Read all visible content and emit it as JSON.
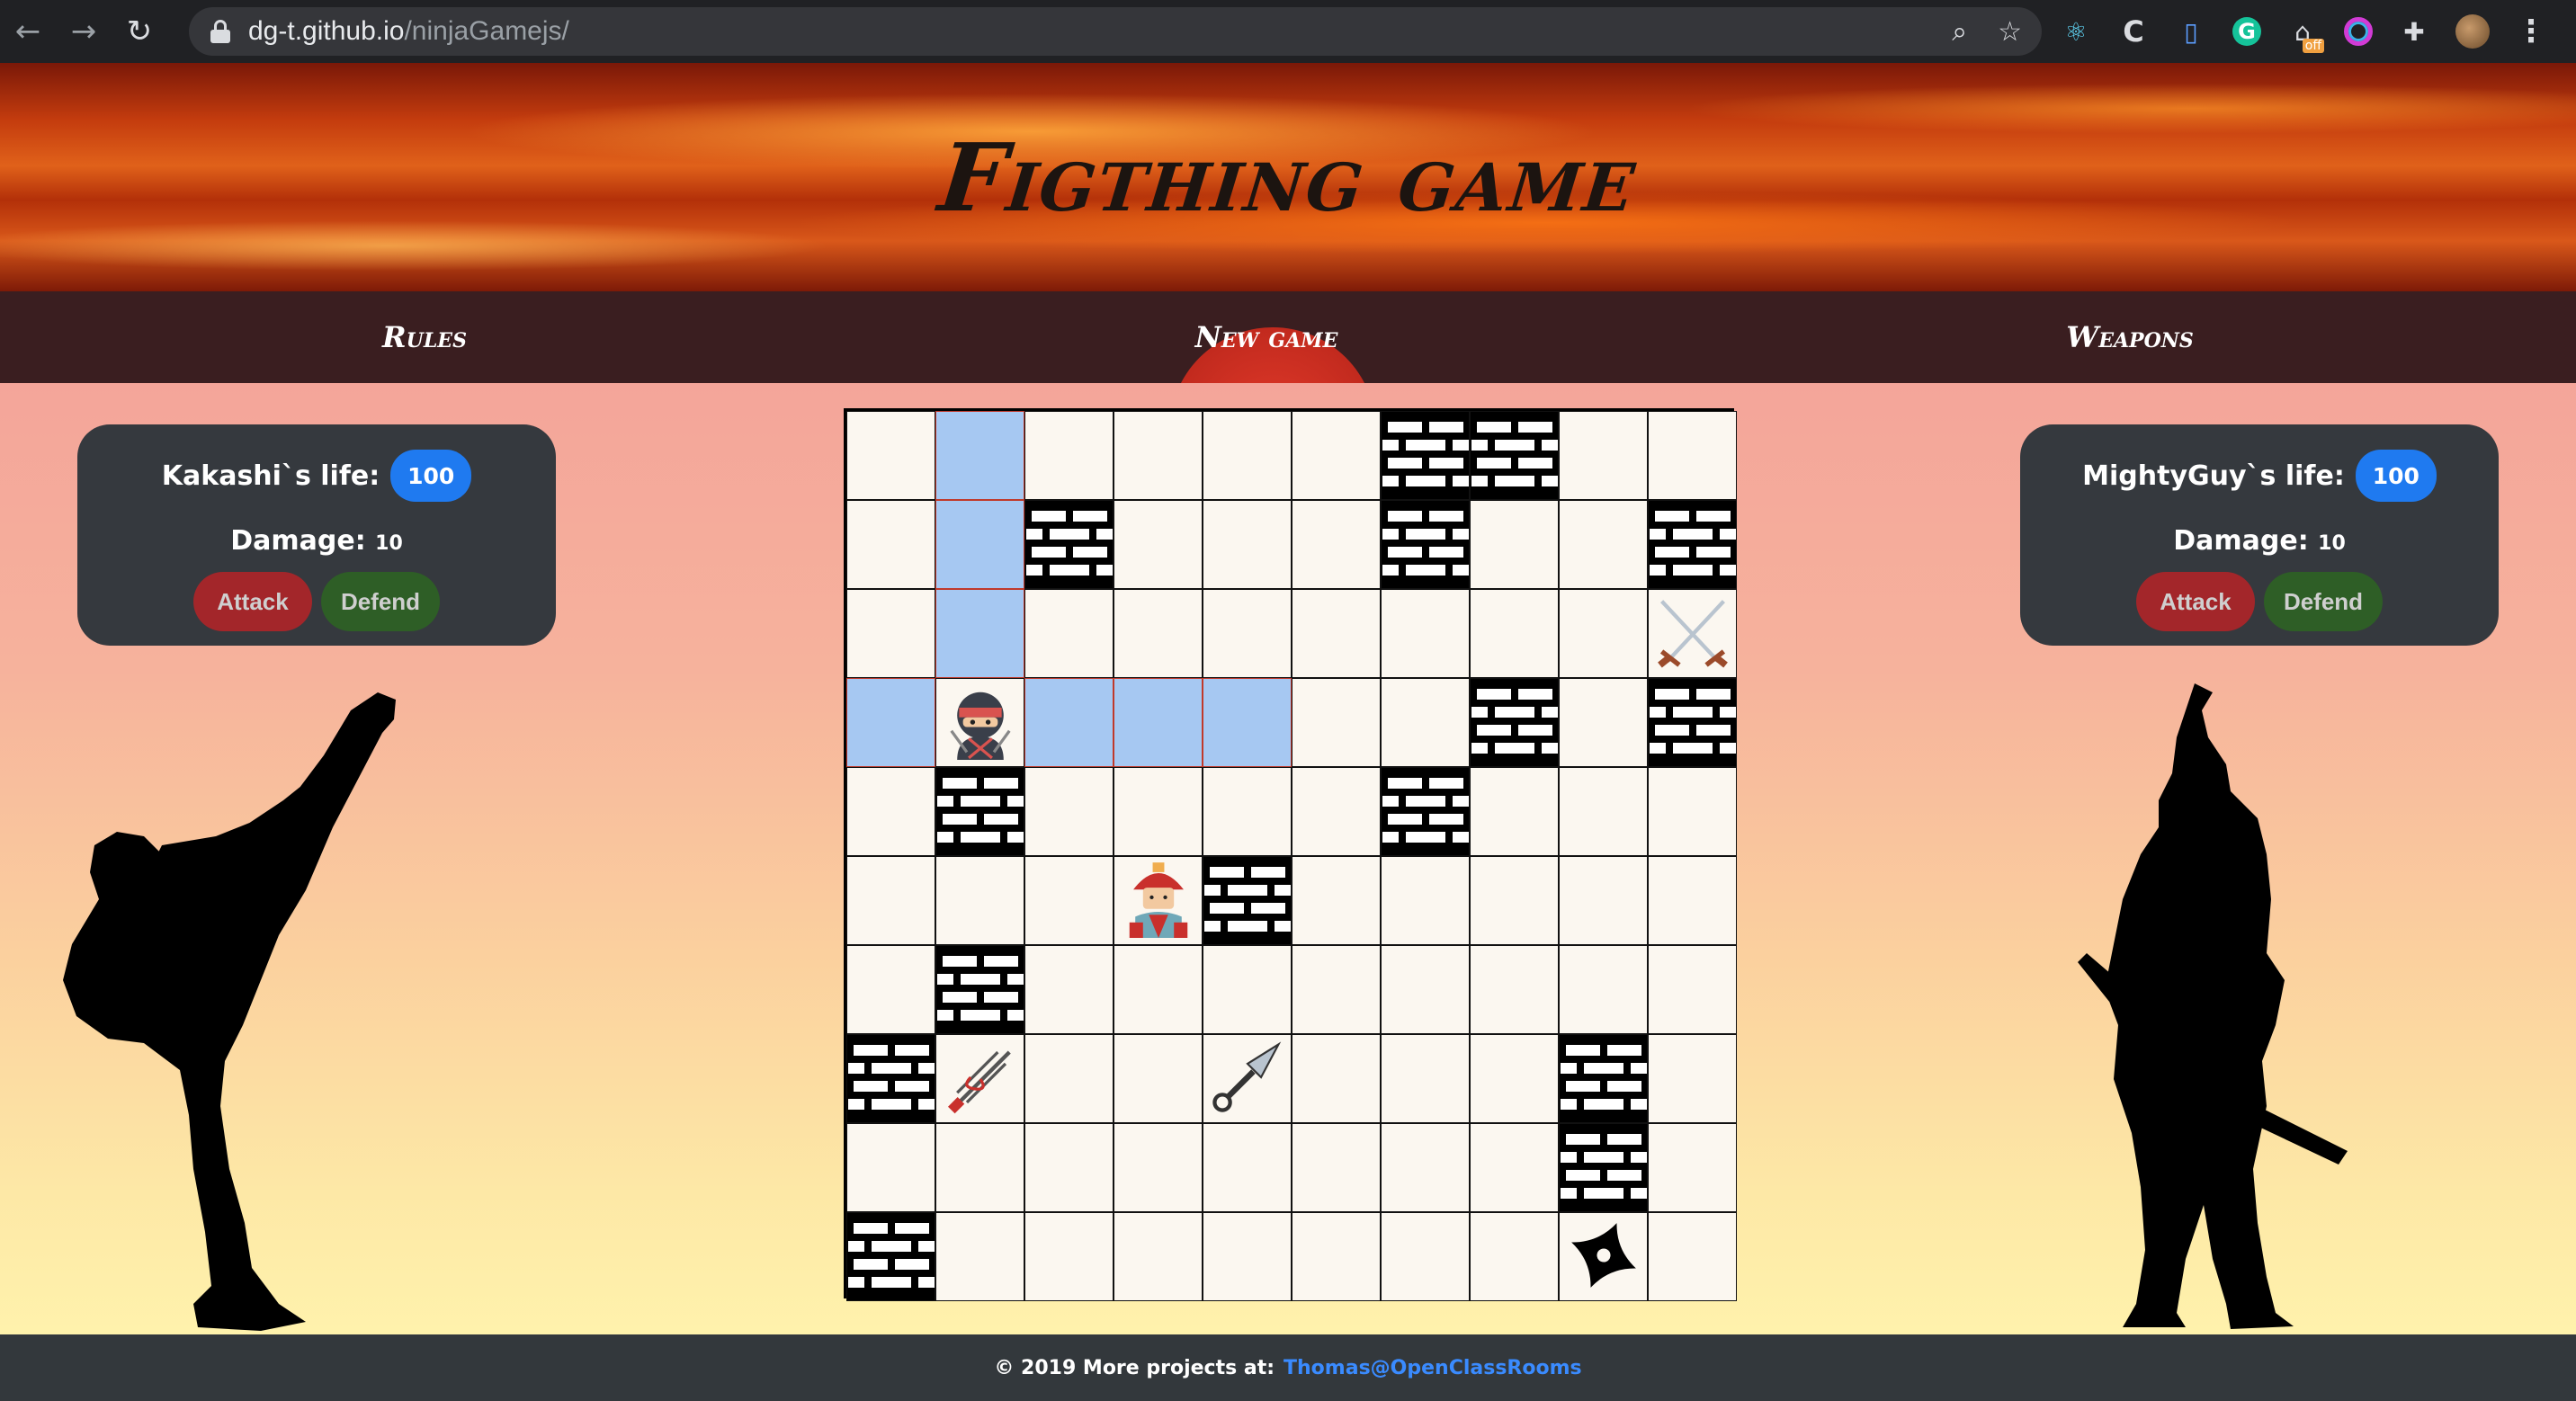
{
  "browser": {
    "url_host": "dg-t.github.io",
    "url_path": "/ninjaGamejs/",
    "ext_badge": "off"
  },
  "header": {
    "title": "Figthing game"
  },
  "nav": {
    "rules": "Rules",
    "new_game": "New game",
    "weapons": "Weapons"
  },
  "player1": {
    "life_label": "Kakashi`s life:",
    "life": "100",
    "damage_label": "Damage:",
    "damage": "10",
    "attack": "Attack",
    "defend": "Defend"
  },
  "player2": {
    "life_label": "MightyGuy`s life:",
    "life": "100",
    "damage_label": "Damage:",
    "damage": "10",
    "attack": "Attack",
    "defend": "Defend"
  },
  "board": {
    "size": 10,
    "walls": [
      [
        0,
        6
      ],
      [
        0,
        7
      ],
      [
        1,
        2
      ],
      [
        1,
        6
      ],
      [
        1,
        9
      ],
      [
        3,
        7
      ],
      [
        3,
        9
      ],
      [
        4,
        1
      ],
      [
        4,
        6
      ],
      [
        5,
        4
      ],
      [
        6,
        1
      ],
      [
        7,
        0
      ],
      [
        7,
        8
      ],
      [
        8,
        8
      ],
      [
        9,
        0
      ]
    ],
    "moves": [
      [
        0,
        1
      ],
      [
        1,
        1
      ],
      [
        2,
        1
      ],
      [
        3,
        0
      ],
      [
        3,
        2
      ],
      [
        3,
        3
      ],
      [
        3,
        4
      ]
    ],
    "pieces": [
      {
        "row": 3,
        "col": 1,
        "icon": "ninja-icon"
      },
      {
        "row": 5,
        "col": 3,
        "icon": "samurai-icon"
      },
      {
        "row": 2,
        "col": 9,
        "icon": "crossed-swords-icon"
      },
      {
        "row": 7,
        "col": 1,
        "icon": "sai-icon"
      },
      {
        "row": 7,
        "col": 4,
        "icon": "kunai-icon"
      },
      {
        "row": 9,
        "col": 8,
        "icon": "shuriken-icon"
      }
    ]
  },
  "footer": {
    "text": "© 2019 More projects at:",
    "link": "Thomas@OpenClassRooms"
  },
  "colors": {
    "life_badge": "#1f7af0",
    "attack": "#a3262a",
    "defend": "#2e5e26",
    "move_cell": "#a6c8f2"
  }
}
